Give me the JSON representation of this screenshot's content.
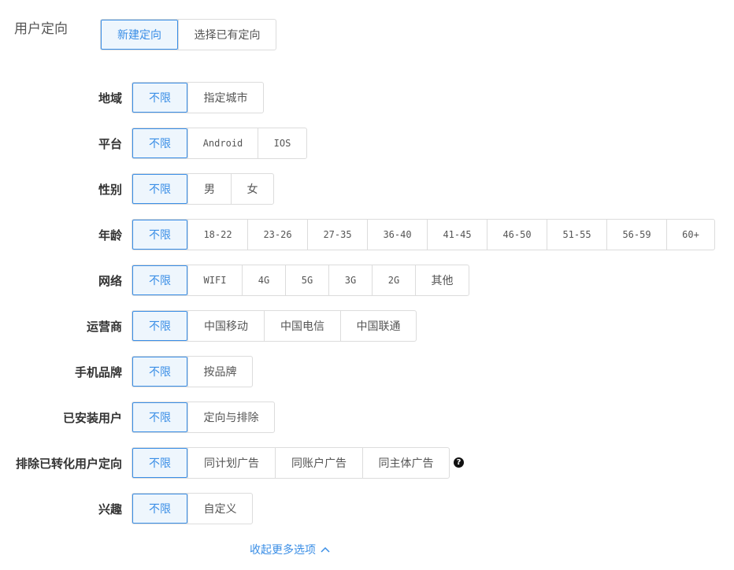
{
  "section": {
    "title": "用户定向",
    "tabs": [
      "新建定向",
      "选择已有定向"
    ],
    "active_tab": 0
  },
  "rows": [
    {
      "label": "地域",
      "options": [
        "不限",
        "指定城市"
      ]
    },
    {
      "label": "平台",
      "options": [
        "不限",
        "Android",
        "IOS"
      ]
    },
    {
      "label": "性别",
      "options": [
        "不限",
        "男",
        "女"
      ]
    },
    {
      "label": "年龄",
      "options": [
        "不限",
        "18-22",
        "23-26",
        "27-35",
        "36-40",
        "41-45",
        "46-50",
        "51-55",
        "56-59",
        "60+"
      ]
    },
    {
      "label": "网络",
      "options": [
        "不限",
        "WIFI",
        "4G",
        "5G",
        "3G",
        "2G",
        "其他"
      ]
    },
    {
      "label": "运营商",
      "options": [
        "不限",
        "中国移动",
        "中国电信",
        "中国联通"
      ]
    },
    {
      "label": "手机品牌",
      "options": [
        "不限",
        "按品牌"
      ]
    },
    {
      "label": "已安装用户",
      "options": [
        "不限",
        "定向与排除"
      ]
    },
    {
      "label": "排除已转化用户定向",
      "options": [
        "不限",
        "同计划广告",
        "同账户广告",
        "同主体广告"
      ]
    },
    {
      "label": "兴趣",
      "options": [
        "不限",
        "自定义"
      ]
    }
  ],
  "help_icon": {
    "glyph": "?",
    "icon": "question-circle-icon"
  },
  "collapse": {
    "label": "收起更多选项",
    "icon": "chevron-up-icon"
  },
  "colors": {
    "accent": "#3a8ee6",
    "active_bg": "#eef6fd",
    "border": "#dcdcdc"
  }
}
